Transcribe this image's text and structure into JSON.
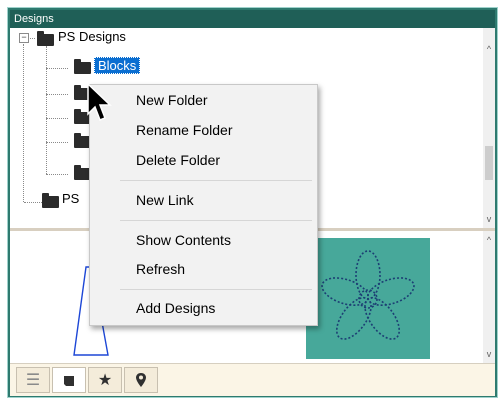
{
  "panel": {
    "title": "Designs"
  },
  "tree": {
    "root_label": "PS Designs",
    "expander_symbol": "−",
    "selected_label": "Blocks",
    "second_root_label": "PS"
  },
  "context_menu": {
    "items": [
      {
        "label": "New Folder"
      },
      {
        "label": "Rename Folder"
      },
      {
        "label": "Delete Folder"
      },
      {
        "label": "New Link"
      },
      {
        "label": "Show Contents"
      },
      {
        "label": "Refresh"
      },
      {
        "label": "Add Designs"
      }
    ]
  },
  "scroll": {
    "up_arrow": "^",
    "down_arrow": "v"
  },
  "tabs": [
    {
      "icon": "list-icon",
      "glyph": "☰"
    },
    {
      "icon": "folder-icon",
      "glyph": ""
    },
    {
      "icon": "star-icon",
      "glyph": "★"
    },
    {
      "icon": "location-pin-icon",
      "glyph": ""
    }
  ],
  "colors": {
    "title_bar": "#1f5f57",
    "panel_border": "#2e7a6f",
    "selection": "#0a6ed1",
    "design_swatch": "#47a89a",
    "design_stitch": "#1c3f74"
  }
}
